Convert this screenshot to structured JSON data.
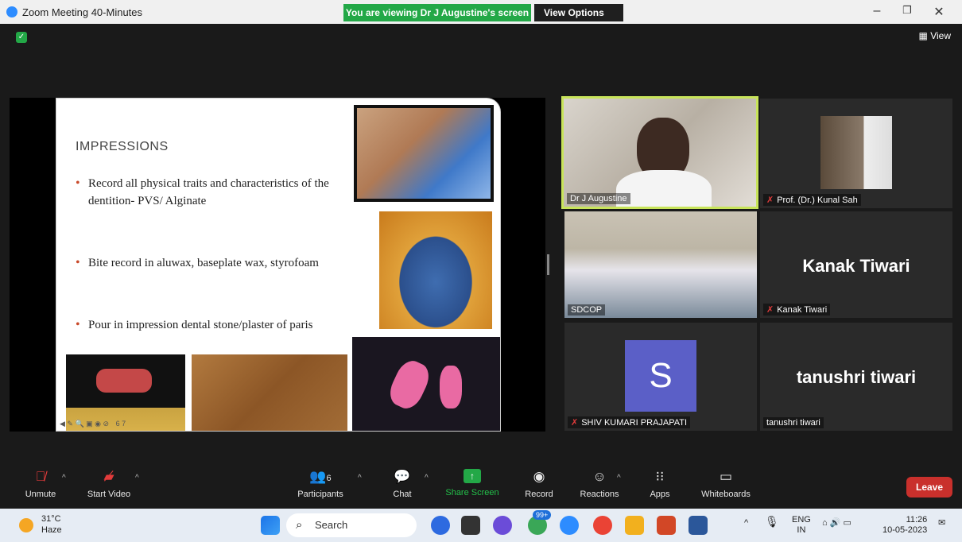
{
  "window": {
    "title": "Zoom Meeting 40-Minutes",
    "banner": "You are viewing Dr J Augustine's screen",
    "view_options": "View Options",
    "view_button": "View"
  },
  "slide": {
    "title": "IMPRESSIONS",
    "bullets": [
      "Record all physical traits and characteristics of the dentition- PVS/ Alginate",
      "Bite record in aluwax, baseplate wax, styrofoam",
      "Pour in impression dental stone/plaster of paris"
    ],
    "ruler_numbers": "6   7"
  },
  "participants": [
    {
      "name": "Dr J Augustine",
      "muted": false
    },
    {
      "name": "Prof. (Dr.) Kunal Sah",
      "muted": true
    },
    {
      "name": "SDCOP",
      "muted": false
    },
    {
      "name": "Kanak Tiwari",
      "muted": true,
      "display": "Kanak Tiwari"
    },
    {
      "name": "SHIV KUMARI PRAJAPATI",
      "muted": true,
      "avatar_letter": "S"
    },
    {
      "name": "tanushri tiwari",
      "muted": false,
      "display": "tanushri tiwari"
    }
  ],
  "controls": {
    "unmute": "Unmute",
    "start_video": "Start Video",
    "participants": "Participants",
    "participants_count": "6",
    "chat": "Chat",
    "share_screen": "Share Screen",
    "record": "Record",
    "reactions": "Reactions",
    "apps": "Apps",
    "whiteboards": "Whiteboards",
    "leave": "Leave"
  },
  "taskbar": {
    "temp": "31°C",
    "weather": "Haze",
    "search_placeholder": "Search",
    "badge": "99+",
    "lang1": "ENG",
    "lang2": "IN",
    "time": "11:26",
    "date": "10-05-2023"
  },
  "colors": {
    "banner_green": "#23a847",
    "leave_red": "#c9302c",
    "active_speaker_border": "#c8e45a",
    "avatar_purple": "#5b5fc7"
  }
}
